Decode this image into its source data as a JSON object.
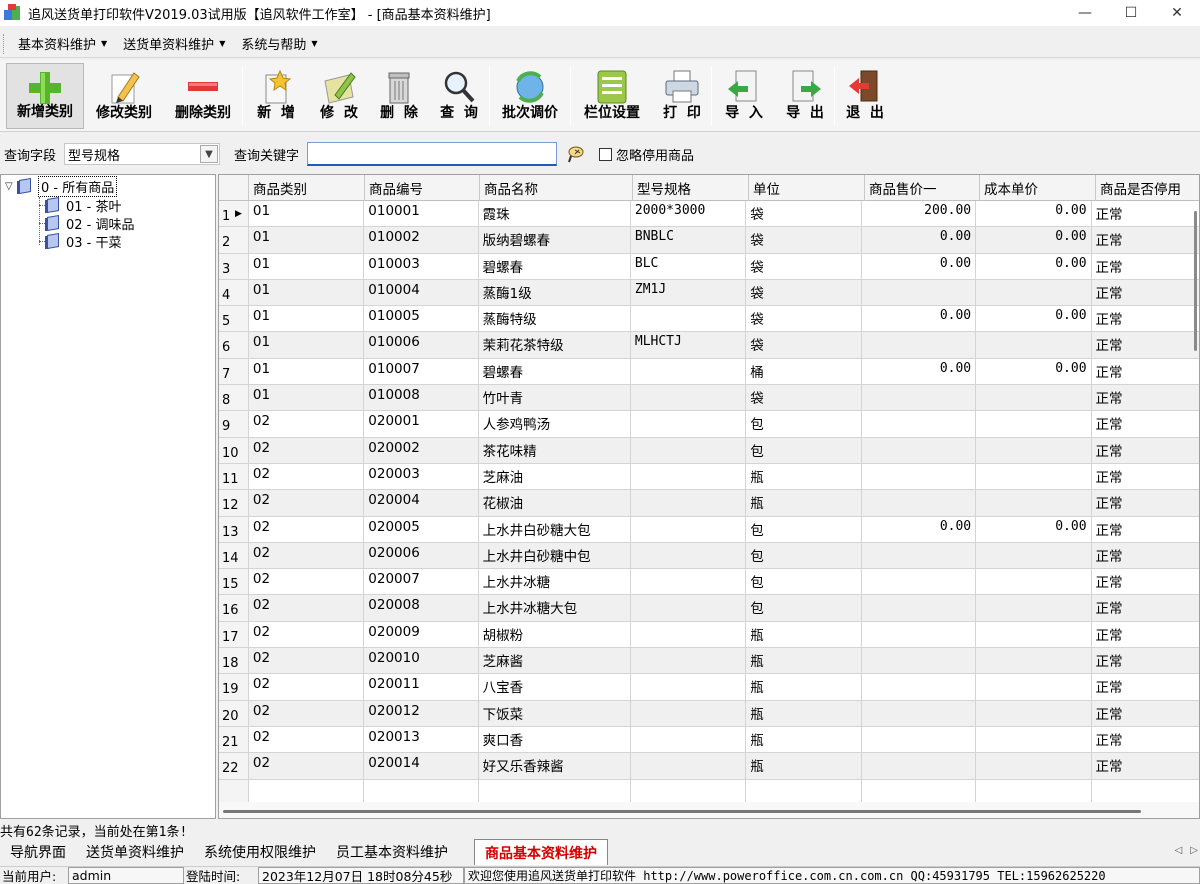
{
  "window": {
    "title": "追风送货单打印软件V2019.03试用版【追风软件工作室】 - [商品基本资料维护]",
    "minimize": "—",
    "maximize": "☐",
    "close": "✕"
  },
  "menu": [
    {
      "label": "基本资料维护"
    },
    {
      "label": "送货单资料维护"
    },
    {
      "label": "系统与帮助"
    }
  ],
  "toolbar": {
    "add_category": "新增类别",
    "edit_category": "修改类别",
    "delete_category": "删除类别",
    "add": "新  增",
    "edit": "修  改",
    "delete": "删  除",
    "query": "查  询",
    "batch_price": "批次调价",
    "column_settings": "栏位设置",
    "print": "打  印",
    "import": "导  入",
    "export": "导  出",
    "exit": "退  出"
  },
  "query": {
    "field_label": "查询字段",
    "field_value": "型号规格",
    "keyword_label": "查询关键字",
    "keyword_value": "",
    "ignore_label": "忽略停用商品",
    "ignore_checked": false
  },
  "tree": {
    "root": "0 - 所有商品",
    "children": [
      "01 - 茶叶",
      "02 - 调味品",
      "03 - 干菜"
    ]
  },
  "grid": {
    "columns": [
      "商品类别",
      "商品编号",
      "商品名称",
      "型号规格",
      "单位",
      "商品售价一",
      "成本单价",
      "商品是否停用"
    ],
    "rows": [
      [
        "01",
        "010001",
        "霞珠",
        "2000*3000",
        "袋",
        "200.00",
        "0.00",
        "正常"
      ],
      [
        "01",
        "010002",
        "版纳碧螺春",
        "BNBLC",
        "袋",
        "0.00",
        "0.00",
        "正常"
      ],
      [
        "01",
        "010003",
        "碧螺春",
        "BLC",
        "袋",
        "0.00",
        "0.00",
        "正常"
      ],
      [
        "01",
        "010004",
        "蒸酶1级",
        "ZM1J",
        "袋",
        "",
        "",
        "正常"
      ],
      [
        "01",
        "010005",
        "蒸酶特级",
        "",
        "袋",
        "0.00",
        "0.00",
        "正常"
      ],
      [
        "01",
        "010006",
        "茉莉花茶特级",
        "MLHCTJ",
        "袋",
        "",
        "",
        "正常"
      ],
      [
        "01",
        "010007",
        "碧螺春",
        "",
        "桶",
        "0.00",
        "0.00",
        "正常"
      ],
      [
        "01",
        "010008",
        "竹叶青",
        "",
        "袋",
        "",
        "",
        "正常"
      ],
      [
        "02",
        "020001",
        "人参鸡鸭汤",
        "",
        "包",
        "",
        "",
        "正常"
      ],
      [
        "02",
        "020002",
        "茶花味精",
        "",
        "包",
        "",
        "",
        "正常"
      ],
      [
        "02",
        "020003",
        "芝麻油",
        "",
        "瓶",
        "",
        "",
        "正常"
      ],
      [
        "02",
        "020004",
        "花椒油",
        "",
        "瓶",
        "",
        "",
        "正常"
      ],
      [
        "02",
        "020005",
        "上水井白砂糖大包",
        "",
        "包",
        "0.00",
        "0.00",
        "正常"
      ],
      [
        "02",
        "020006",
        "上水井白砂糖中包",
        "",
        "包",
        "",
        "",
        "正常"
      ],
      [
        "02",
        "020007",
        "上水井冰糖",
        "",
        "包",
        "",
        "",
        "正常"
      ],
      [
        "02",
        "020008",
        "上水井冰糖大包",
        "",
        "包",
        "",
        "",
        "正常"
      ],
      [
        "02",
        "020009",
        "胡椒粉",
        "",
        "瓶",
        "",
        "",
        "正常"
      ],
      [
        "02",
        "020010",
        "芝麻酱",
        "",
        "瓶",
        "",
        "",
        "正常"
      ],
      [
        "02",
        "020011",
        "八宝香",
        "",
        "瓶",
        "",
        "",
        "正常"
      ],
      [
        "02",
        "020012",
        "下饭菜",
        "",
        "瓶",
        "",
        "",
        "正常"
      ],
      [
        "02",
        "020013",
        "爽口香",
        "",
        "瓶",
        "",
        "",
        "正常"
      ],
      [
        "02",
        "020014",
        "好又乐香辣酱",
        "",
        "瓶",
        "",
        "",
        "正常"
      ]
    ],
    "row_numbers": [
      "1",
      "2",
      "3",
      "4",
      "5",
      "6",
      "7",
      "8",
      "9",
      "10",
      "11",
      "12",
      "13",
      "14",
      "15",
      "16",
      "17",
      "18",
      "19",
      "20",
      "21",
      "22"
    ]
  },
  "record_status": "共有62条记录，当前处在第1条!",
  "tabs": [
    {
      "label": "导航界面"
    },
    {
      "label": "送货单资料维护"
    },
    {
      "label": "系统使用权限维护"
    },
    {
      "label": "员工基本资料维护"
    },
    {
      "label": "商品基本资料维护",
      "active": true
    }
  ],
  "statusbar": {
    "user_label": "当前用户:",
    "user_value": "admin",
    "login_label": "登陆时间:",
    "login_value": "2023年12月07日 18时08分45秒",
    "welcome": "欢迎您使用追风送货单打印软件 http://www.poweroffice.com.cn.com.cn QQ:45931795 TEL:15962625220"
  },
  "colors": {
    "active_tab_text": "#d40000",
    "input_focus_border": "#1e5cc0"
  }
}
